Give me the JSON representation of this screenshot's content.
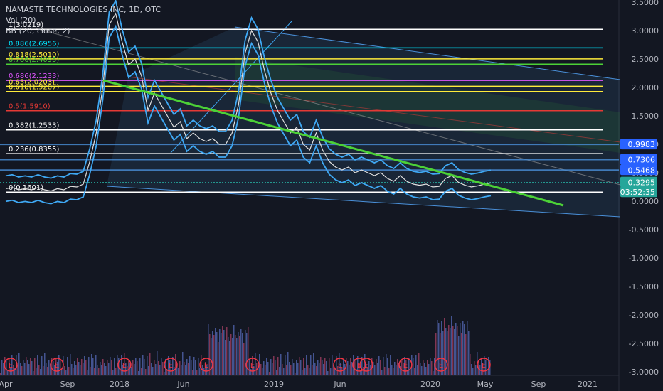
{
  "legend": {
    "title": "NAMASTE TECHNOLOGIES INC, 1D, OTC",
    "vol": "Vol (20)",
    "bb": "BB (20, close, 2)"
  },
  "colors": {
    "background": "#131722",
    "fib_band": "#4a90d9",
    "trendline": "#4cd137",
    "bb_band": "#3fa9f5",
    "volume": "#5a6fc1",
    "earnings": "#f23645",
    "axis_text": "#b2b5be"
  },
  "chart_data": {
    "type": "line",
    "title": "NAMASTE TECHNOLOGIES INC, 1D, OTC",
    "y_axis": {
      "min": -3.0,
      "max": 3.5,
      "ticks": [
        "3.5000",
        "3.0000",
        "2.5000",
        "2.0000",
        "1.5000",
        "1.0000",
        "0.5000",
        "0.0000",
        "-0.5000",
        "-1.0000",
        "-1.5000",
        "-2.0000",
        "-2.5000",
        "-3.0000"
      ],
      "tick_values": [
        3.5,
        3.0,
        2.5,
        2.0,
        1.5,
        1.0,
        0.5,
        0.0,
        -0.5,
        -1.0,
        -1.5,
        -2.0,
        -2.5,
        -3.0
      ]
    },
    "x_axis": {
      "ticks": [
        "Apr",
        "Sep",
        "2018",
        "Jun",
        "2019",
        "Jun",
        "2020",
        "May",
        "Sep",
        "2021"
      ]
    },
    "fib_levels": [
      {
        "label": "1(3.0219)",
        "value": 3.0219,
        "color": "#ffffff"
      },
      {
        "label": "0.886(2.6956)",
        "value": 2.6956,
        "color": "#00e5ff"
      },
      {
        "label": "0.818(2.5010)",
        "value": 2.501,
        "color": "#ffeb3b"
      },
      {
        "label": "0.786(2.4095)",
        "value": 2.4095,
        "color": "#4cd137"
      },
      {
        "label": "0.686(2.1233)",
        "value": 2.1233,
        "color": "#e056fd"
      },
      {
        "label": "0.65(2.0203)",
        "value": 2.0203,
        "color": "#ffeb3b"
      },
      {
        "label": "0.618(1.9287)",
        "value": 1.9287,
        "color": "#ffeb3b"
      },
      {
        "label": "0.5(1.5910)",
        "value": 1.591,
        "color": "#e53935"
      },
      {
        "label": "0.382(1.2533)",
        "value": 1.2533,
        "color": "#ffffff"
      },
      {
        "label": "0.236(0.8355)",
        "value": 0.8355,
        "color": "#ffffff"
      },
      {
        "label": "0(0.1601)",
        "value": 0.1601,
        "color": "#ffffff"
      }
    ],
    "price_labels": [
      {
        "label": "0.9983",
        "value": 0.9983,
        "bg": "#2962ff",
        "fg": "#ffffff"
      },
      {
        "label": "0.7306",
        "value": 0.7306,
        "bg": "#2962ff",
        "fg": "#ffffff"
      },
      {
        "label": "0.5468",
        "value": 0.5468,
        "bg": "#2962ff",
        "fg": "#ffffff"
      },
      {
        "label": "0.3295",
        "value": 0.3295,
        "bg": "#26a69a",
        "fg": "#ffffff"
      },
      {
        "label": "03:52:35",
        "value": 0.16,
        "bg": "#26a69a",
        "fg": "#ffffff"
      }
    ],
    "series": [
      {
        "values": [
          0.22,
          0.24,
          0.2,
          0.22,
          0.2,
          0.24,
          0.2,
          0.18,
          0.22,
          0.2,
          0.26,
          0.25,
          0.3,
          0.7,
          1.2,
          2.0,
          3.1,
          3.3,
          2.8,
          2.4,
          2.5,
          2.2,
          1.6,
          1.9,
          1.7,
          1.5,
          1.3,
          1.4,
          1.1,
          1.2,
          1.1,
          1.05,
          1.1,
          1.0,
          1.0,
          1.2,
          1.7,
          2.6,
          3.0,
          2.8,
          2.3,
          1.9,
          1.6,
          1.4,
          1.2,
          1.3,
          1.0,
          0.9,
          1.2,
          0.9,
          0.7,
          0.6,
          0.55,
          0.6,
          0.5,
          0.55,
          0.5,
          0.45,
          0.5,
          0.4,
          0.35,
          0.45,
          0.35,
          0.3,
          0.28,
          0.3,
          0.25,
          0.26,
          0.4,
          0.45,
          0.33,
          0.28,
          0.25,
          0.27,
          0.3,
          0.32
        ]
      }
    ],
    "earnings_markers": [
      "E",
      "E",
      "E",
      "E",
      "E",
      "E",
      "E",
      "E",
      "E",
      "E",
      "E",
      "E",
      "E"
    ]
  }
}
